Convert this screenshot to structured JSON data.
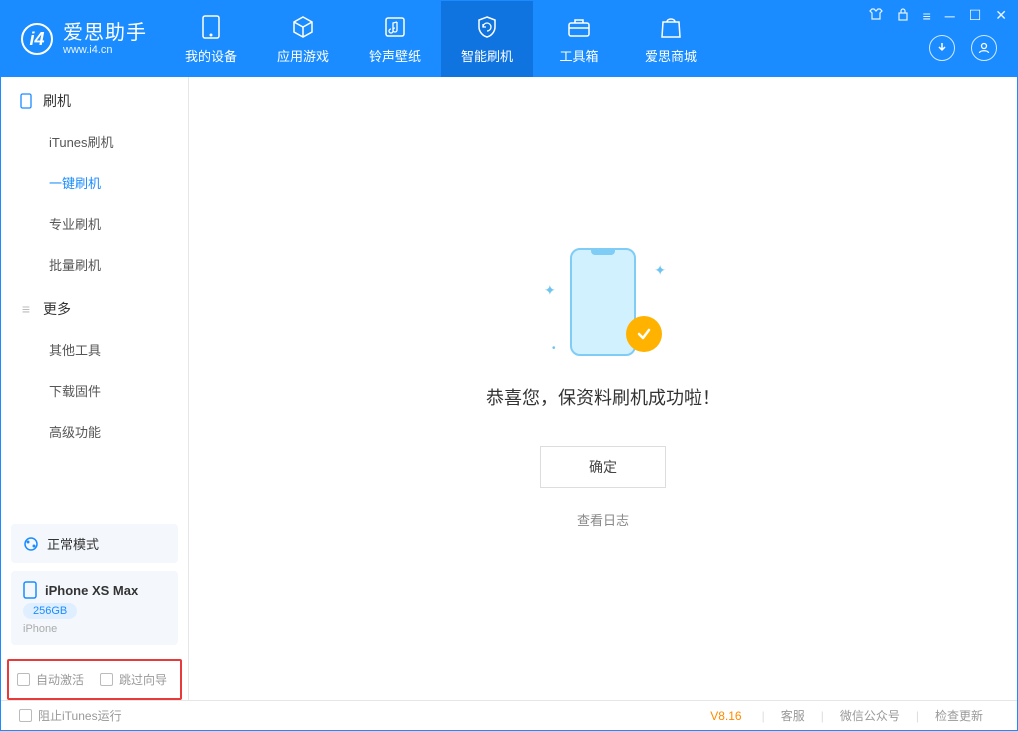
{
  "app": {
    "title": "爱思助手",
    "subtitle": "www.i4.cn"
  },
  "nav": {
    "tabs": [
      {
        "label": "我的设备"
      },
      {
        "label": "应用游戏"
      },
      {
        "label": "铃声壁纸"
      },
      {
        "label": "智能刷机"
      },
      {
        "label": "工具箱"
      },
      {
        "label": "爱思商城"
      }
    ]
  },
  "sidebar": {
    "group1": {
      "title": "刷机",
      "items": [
        "iTunes刷机",
        "一键刷机",
        "专业刷机",
        "批量刷机"
      ]
    },
    "group2": {
      "title": "更多",
      "items": [
        "其他工具",
        "下载固件",
        "高级功能"
      ]
    },
    "mode": "正常模式",
    "device": {
      "name": "iPhone XS Max",
      "storage": "256GB",
      "type": "iPhone"
    },
    "options": {
      "opt1": "自动激活",
      "opt2": "跳过向导"
    }
  },
  "main": {
    "success": "恭喜您，保资料刷机成功啦！",
    "confirm": "确定",
    "view_log": "查看日志"
  },
  "footer": {
    "block_itunes": "阻止iTunes运行",
    "version": "V8.16",
    "links": [
      "客服",
      "微信公众号",
      "检查更新"
    ]
  }
}
